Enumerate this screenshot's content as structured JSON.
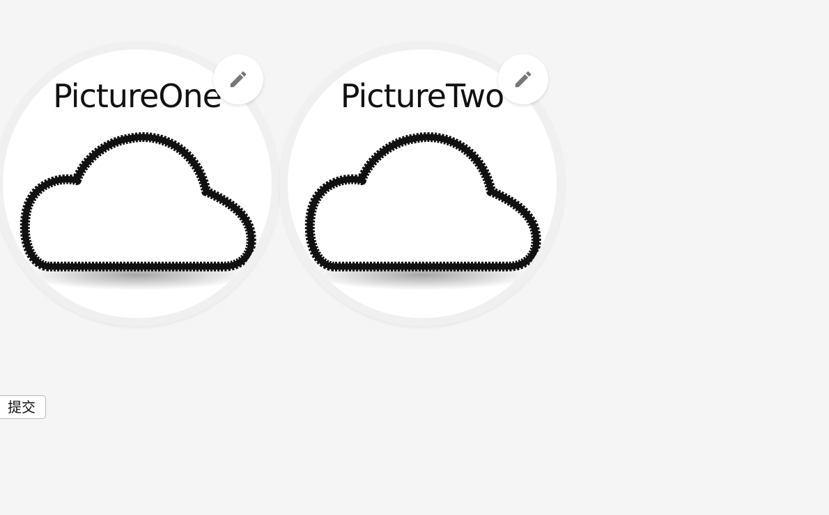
{
  "uploads": [
    {
      "label": "PictureOne",
      "image_icon": "cloud-icon",
      "edit_icon": "pencil-icon"
    },
    {
      "label": "PictureTwo",
      "image_icon": "cloud-icon",
      "edit_icon": "pencil-icon"
    }
  ],
  "submit": {
    "label": "提交"
  },
  "colors": {
    "page_background": "#f5f5f5",
    "preview_border": "#f0f0f0",
    "icon_gray": "#777777"
  }
}
